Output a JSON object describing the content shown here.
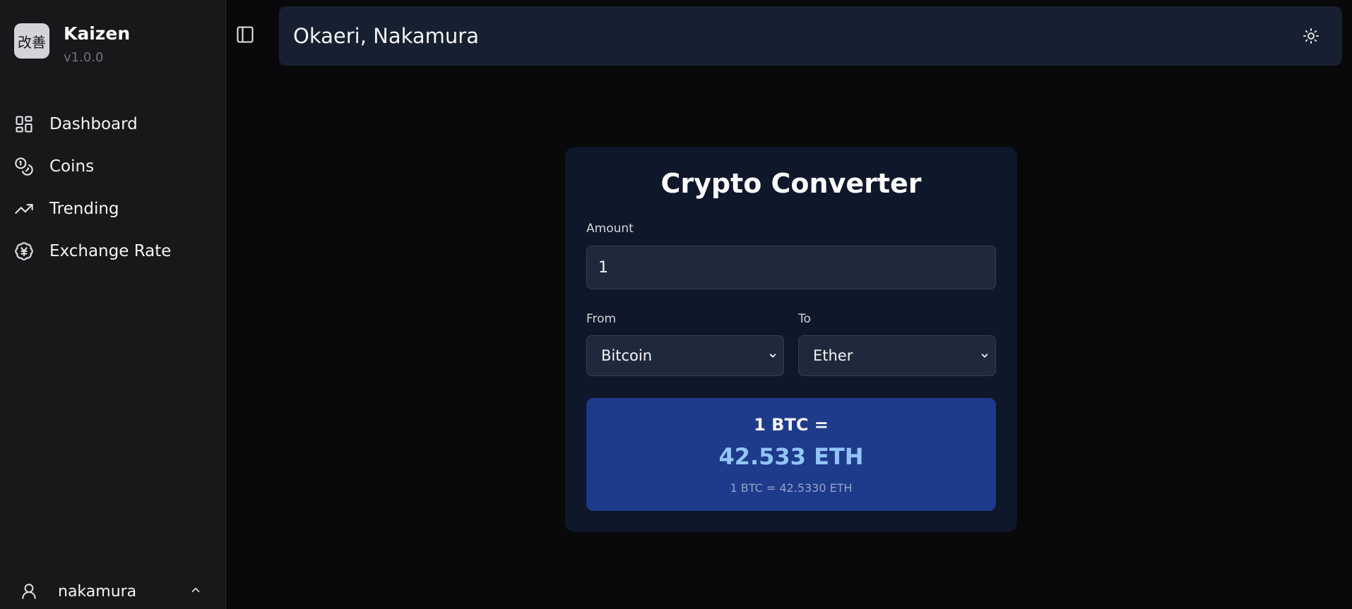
{
  "sidebar": {
    "logo_text": "改善",
    "app_name": "Kaizen",
    "version": "v1.0.0",
    "nav": [
      {
        "label": "Dashboard",
        "icon": "dashboard-icon"
      },
      {
        "label": "Coins",
        "icon": "coins-icon"
      },
      {
        "label": "Trending",
        "icon": "trending-icon"
      },
      {
        "label": "Exchange Rate",
        "icon": "yen-badge-icon"
      }
    ],
    "user": {
      "name": "nakamura",
      "icon": "user-icon"
    }
  },
  "header": {
    "greeting": "Okaeri, Nakamura",
    "toggle_icon": "sidebar-toggle-icon",
    "theme_icon": "sun-icon"
  },
  "converter": {
    "title": "Crypto Converter",
    "amount_label": "Amount",
    "amount_value": "1",
    "from_label": "From",
    "from_value": "Bitcoin",
    "to_label": "To",
    "to_value": "Ether",
    "result_line1": "1 BTC =",
    "result_line2": "42.533 ETH",
    "result_line3": "1 BTC = 42.5330 ETH"
  },
  "colors": {
    "background": "#09090b",
    "sidebar": "#18181b",
    "header": "#172031",
    "card": "#0f172a",
    "result": "#1e3a8a",
    "accent": "#93c5fd"
  }
}
